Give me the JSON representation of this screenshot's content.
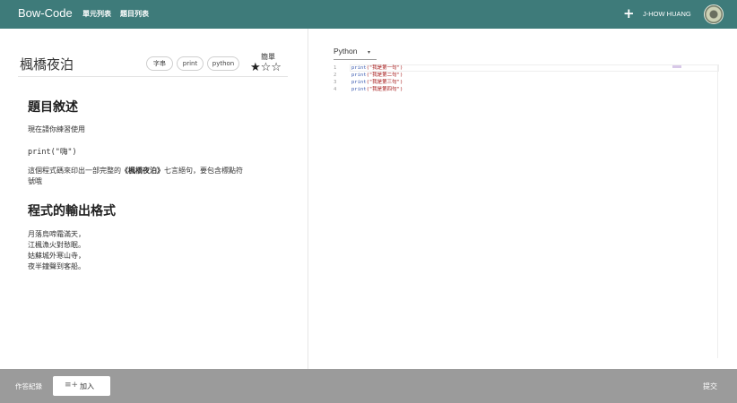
{
  "header": {
    "brand": "Bow-Code",
    "nav": [
      "單元列表",
      "題目列表"
    ],
    "add_icon": "+",
    "user_name": "J-HOW HUANG",
    "avatar_icon": "avatar"
  },
  "problem": {
    "title": "楓橋夜泊",
    "tags": [
      "字串",
      "print",
      "python"
    ],
    "difficulty_label": "簡單",
    "stars": "★☆☆",
    "rating": 1,
    "rating_max": 3,
    "description_heading": "題目敘述",
    "description_line1": "現在請你練習使用",
    "description_code": "print(\"嗨\")",
    "description_line2_prefix": "這個程式碼來印出一部完整的",
    "description_line2_bold": "《楓橋夜泊》",
    "description_line2_suffix": "七言絕句，要包含標點符",
    "description_line3": "號哦",
    "output_heading": "程式的輸出格式",
    "output_lines": [
      "月落烏啼霜滿天，",
      "江楓漁火對愁眠。",
      "姑蘇城外寒山寺，",
      "夜半鐘聲到客船。"
    ]
  },
  "editor": {
    "language": "Python",
    "caret_icon": "▾",
    "lines": [
      {
        "no": "1",
        "fn": "print",
        "arg": "(\"我是第一句\")"
      },
      {
        "no": "2",
        "fn": "print",
        "arg": "(\"我是第二句\")"
      },
      {
        "no": "3",
        "fn": "print",
        "arg": "(\"我是第三句\")"
      },
      {
        "no": "4",
        "fn": "print",
        "arg": "(\"我是第四句\")"
      }
    ]
  },
  "footer": {
    "history_label": "作答紀錄",
    "join_icon": "≡+",
    "join_label": "加入",
    "submit_label": "提交"
  }
}
